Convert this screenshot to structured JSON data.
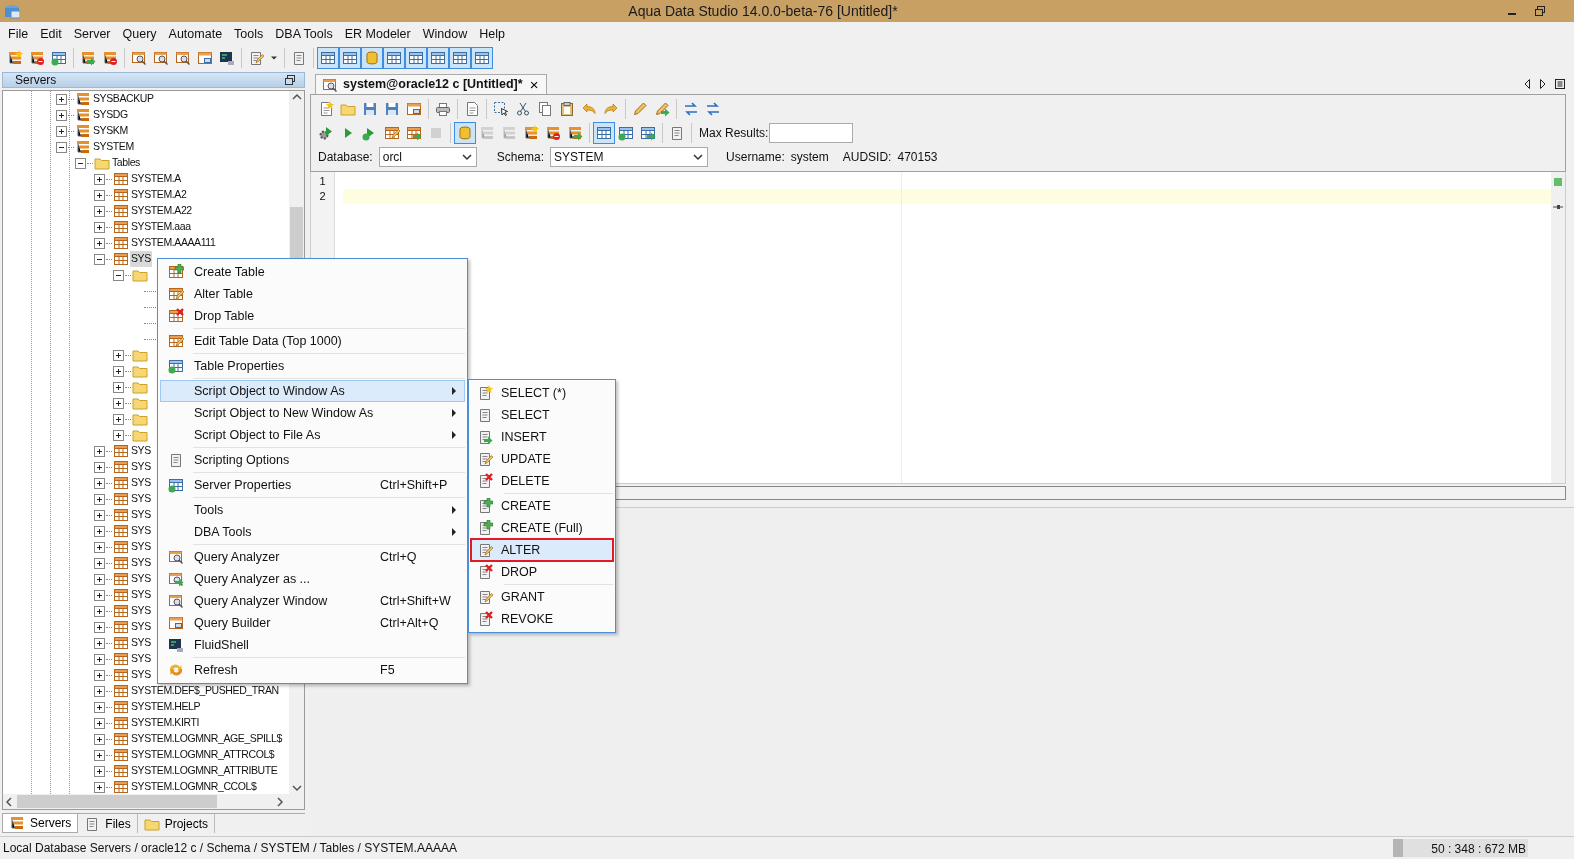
{
  "window": {
    "title": "Aqua Data Studio 14.0.0-beta-76 [Untitled]*"
  },
  "menu_bar": [
    "File",
    "Edit",
    "Server",
    "Query",
    "Automate",
    "Tools",
    "DBA Tools",
    "ER Modeler",
    "Window",
    "Help"
  ],
  "toolbar": [
    {
      "kind": "server-star",
      "pressed": false
    },
    {
      "kind": "server-ban",
      "pressed": false
    },
    {
      "kind": "grid-dot",
      "pressed": false
    },
    {
      "kind": "separator"
    },
    {
      "kind": "server-arrow",
      "pressed": false
    },
    {
      "kind": "server-ban",
      "pressed": false
    },
    {
      "kind": "separator"
    },
    {
      "kind": "magnifier",
      "pressed": false
    },
    {
      "kind": "magnifier",
      "pressed": false
    },
    {
      "kind": "magnifier",
      "pressed": false
    },
    {
      "kind": "window",
      "pressed": false
    },
    {
      "kind": "terminal",
      "pressed": false
    },
    {
      "kind": "separator"
    },
    {
      "kind": "scroll-pencil",
      "pressed": false
    },
    {
      "kind": "caret",
      "pressed": false
    },
    {
      "kind": "separator"
    },
    {
      "kind": "scroll",
      "pressed": false
    },
    {
      "kind": "separator"
    },
    {
      "kind": "grid",
      "pressed": true
    },
    {
      "kind": "grid",
      "pressed": true
    },
    {
      "kind": "cylinder",
      "pressed": true
    },
    {
      "kind": "grid",
      "pressed": true
    },
    {
      "kind": "grid",
      "pressed": true
    },
    {
      "kind": "grid",
      "pressed": true
    },
    {
      "kind": "grid",
      "pressed": true
    },
    {
      "kind": "grid",
      "pressed": true
    }
  ],
  "servers_panel": {
    "title": "Servers",
    "tree": [
      {
        "kind": "server",
        "label": "SYSBACKUP",
        "expanded": false,
        "selected": false
      },
      {
        "kind": "server",
        "label": "SYSDG",
        "expanded": false,
        "selected": false
      },
      {
        "kind": "server",
        "label": "SYSKM",
        "expanded": false,
        "selected": false
      },
      {
        "kind": "server",
        "label": "SYSTEM",
        "expanded": true,
        "selected": false,
        "children": [
          {
            "kind": "folder",
            "label": "Tables",
            "expanded": true,
            "selected": false,
            "children": [
              {
                "kind": "table",
                "label": "SYSTEM.A",
                "expanded": false,
                "selected": false
              },
              {
                "kind": "table",
                "label": "SYSTEM.A2",
                "expanded": false,
                "selected": false
              },
              {
                "kind": "table",
                "label": "SYSTEM.A22",
                "expanded": false,
                "selected": false
              },
              {
                "kind": "table",
                "label": "SYSTEM.aaa",
                "expanded": false,
                "selected": false
              },
              {
                "kind": "table",
                "label": "SYSTEM.AAAA111",
                "expanded": false,
                "selected": false
              },
              {
                "kind": "table",
                "label": "SYS",
                "expanded": true,
                "selected": true,
                "children": [
                  {
                    "kind": "folder",
                    "expanded": true,
                    "children": [
                      {
                        "kind": "covered"
                      },
                      {
                        "kind": "covered"
                      },
                      {
                        "kind": "covered"
                      },
                      {
                        "kind": "covered"
                      }
                    ]
                  },
                  {
                    "kind": "folder",
                    "expanded": false
                  },
                  {
                    "kind": "folder",
                    "expanded": false
                  },
                  {
                    "kind": "folder",
                    "expanded": false
                  },
                  {
                    "kind": "folder",
                    "expanded": false
                  },
                  {
                    "kind": "folder",
                    "expanded": false
                  },
                  {
                    "kind": "folder",
                    "expanded": false
                  }
                ]
              },
              {
                "kind": "table",
                "label": "SYS",
                "expanded": false,
                "selected": false
              },
              {
                "kind": "table",
                "label": "SYS",
                "expanded": false,
                "selected": false
              },
              {
                "kind": "table",
                "label": "SYS",
                "expanded": false,
                "selected": false
              },
              {
                "kind": "table",
                "label": "SYS",
                "expanded": false,
                "selected": false
              },
              {
                "kind": "table",
                "label": "SYS",
                "expanded": false,
                "selected": false
              },
              {
                "kind": "table",
                "label": "SYS",
                "expanded": false,
                "selected": false
              },
              {
                "kind": "table",
                "label": "SYS",
                "expanded": false,
                "selected": false
              },
              {
                "kind": "table",
                "label": "SYS",
                "expanded": false,
                "selected": false
              },
              {
                "kind": "table",
                "label": "SYS",
                "expanded": false,
                "selected": false
              },
              {
                "kind": "table",
                "label": "SYS",
                "expanded": false,
                "selected": false
              },
              {
                "kind": "table",
                "label": "SYS",
                "expanded": false,
                "selected": false
              },
              {
                "kind": "table",
                "label": "SYS",
                "expanded": false,
                "selected": false
              },
              {
                "kind": "table",
                "label": "SYS",
                "expanded": false,
                "selected": false
              },
              {
                "kind": "table",
                "label": "SYS",
                "expanded": false,
                "selected": false
              },
              {
                "kind": "table",
                "label": "SYS",
                "expanded": false,
                "selected": false
              },
              {
                "kind": "table",
                "label": "SYSTEM.DEF$_PUSHED_TRAN",
                "expanded": false,
                "selected": false
              },
              {
                "kind": "table",
                "label": "SYSTEM.HELP",
                "expanded": false,
                "selected": false
              },
              {
                "kind": "table",
                "label": "SYSTEM.KIRTI",
                "expanded": false,
                "selected": false
              },
              {
                "kind": "table",
                "label": "SYSTEM.LOGMNR_AGE_SPILL$",
                "expanded": false,
                "selected": false
              },
              {
                "kind": "table",
                "label": "SYSTEM.LOGMNR_ATTRCOL$",
                "expanded": false,
                "selected": false
              },
              {
                "kind": "table",
                "label": "SYSTEM.LOGMNR_ATTRIBUTE",
                "expanded": false,
                "selected": false
              },
              {
                "kind": "table",
                "label": "SYSTEM.LOGMNR_CCOL$",
                "expanded": false,
                "selected": false
              }
            ]
          }
        ]
      }
    ],
    "tabs": [
      {
        "kind": "server",
        "label": "Servers",
        "selected": true
      },
      {
        "kind": "scroll",
        "label": "Files",
        "selected": false
      },
      {
        "kind": "folder",
        "label": "Projects",
        "selected": false
      }
    ]
  },
  "editor": {
    "tab": {
      "label": "system@oracle12 c [Untitled]*",
      "close": "×"
    },
    "toolbar_rows": [
      [
        {
          "kind": "document-star"
        },
        {
          "kind": "folder"
        },
        {
          "kind": "floppy"
        },
        {
          "kind": "floppy"
        },
        {
          "kind": "window"
        },
        {
          "kind": "separator"
        },
        {
          "kind": "printer"
        },
        {
          "kind": "separator"
        },
        {
          "kind": "document"
        },
        {
          "kind": "separator"
        },
        {
          "kind": "selection"
        },
        {
          "kind": "scissors"
        },
        {
          "kind": "copy"
        },
        {
          "kind": "clipboard"
        },
        {
          "kind": "undo"
        },
        {
          "kind": "redo"
        },
        {
          "kind": "separator"
        },
        {
          "kind": "pencil"
        },
        {
          "kind": "pencil-arrow"
        },
        {
          "kind": "separator"
        },
        {
          "kind": "arrows"
        },
        {
          "kind": "arrows"
        }
      ],
      [
        {
          "kind": "gear",
          "pressed": false,
          "disabled": false
        },
        {
          "kind": "play",
          "pressed": false,
          "disabled": false
        },
        {
          "kind": "play-dot",
          "pressed": false,
          "disabled": false
        },
        {
          "kind": "table-pencil",
          "pressed": false,
          "disabled": false
        },
        {
          "kind": "table-arrow",
          "pressed": false,
          "disabled": false
        },
        {
          "kind": "stop",
          "pressed": false,
          "disabled": true
        },
        {
          "kind": "separator"
        },
        {
          "kind": "cylinder",
          "pressed": true,
          "disabled": false
        },
        {
          "kind": "server",
          "pressed": false,
          "disabled": true
        },
        {
          "kind": "server",
          "pressed": false,
          "disabled": true
        },
        {
          "kind": "server-star",
          "pressed": false,
          "disabled": false
        },
        {
          "kind": "server-ban",
          "pressed": false,
          "disabled": false
        },
        {
          "kind": "server-arrow",
          "pressed": false,
          "disabled": false
        },
        {
          "kind": "separator"
        },
        {
          "kind": "grid",
          "pressed": true,
          "disabled": false
        },
        {
          "kind": "grid-dot",
          "pressed": false,
          "disabled": false
        },
        {
          "kind": "grid-arrow",
          "pressed": false,
          "disabled": false
        },
        {
          "kind": "separator"
        },
        {
          "kind": "scroll",
          "pressed": false,
          "disabled": false
        },
        {
          "kind": "separator"
        }
      ]
    ],
    "max_results": {
      "label": "Max Results:"
    },
    "database": {
      "label": "Database:",
      "value": "orcl"
    },
    "schema": {
      "label": "Schema:",
      "value": "SYSTEM"
    },
    "username": {
      "label": "Username:",
      "value": "system"
    },
    "audsid": {
      "label": "AUDSID:",
      "value": "470153"
    },
    "lines": [
      {
        "number": "1",
        "current": false
      },
      {
        "number": "2",
        "current": true
      }
    ]
  },
  "context_menu": {
    "items": [
      {
        "kind": "table-plus",
        "label": "Create Table",
        "selected": false
      },
      {
        "kind": "table-pencil",
        "label": "Alter Table",
        "selected": false
      },
      {
        "kind": "table-x",
        "label": "Drop Table",
        "selected": false
      },
      {
        "kind": "separator"
      },
      {
        "kind": "table-pencil",
        "label": "Edit Table Data (Top 1000)",
        "selected": false
      },
      {
        "kind": "separator"
      },
      {
        "kind": "grid-dot",
        "label": "Table Properties",
        "selected": false
      },
      {
        "kind": "separator"
      },
      {
        "kind": "plain",
        "label": "Script Object to Window As",
        "submenu": true,
        "selected": true
      },
      {
        "kind": "plain",
        "label": "Script Object to New Window As",
        "submenu": true,
        "selected": false
      },
      {
        "kind": "plain",
        "label": "Script Object to File As",
        "submenu": true,
        "selected": false
      },
      {
        "kind": "separator"
      },
      {
        "kind": "scroll",
        "label": "Scripting Options",
        "selected": false
      },
      {
        "kind": "separator"
      },
      {
        "kind": "grid-dot",
        "label": "Server Properties",
        "shortcut": "Ctrl+Shift+P",
        "selected": false
      },
      {
        "kind": "separator"
      },
      {
        "kind": "plain",
        "label": "Tools",
        "submenu": true,
        "selected": false
      },
      {
        "kind": "plain",
        "label": "DBA Tools",
        "submenu": true,
        "selected": false
      },
      {
        "kind": "separator"
      },
      {
        "kind": "magnifier",
        "label": "Query Analyzer",
        "shortcut": "Ctrl+Q",
        "selected": false
      },
      {
        "kind": "magnifier-arrow",
        "label": "Query Analyzer as ...",
        "selected": false
      },
      {
        "kind": "magnifier",
        "label": "Query Analyzer Window",
        "shortcut": "Ctrl+Shift+W",
        "selected": false
      },
      {
        "kind": "window",
        "label": "Query Builder",
        "shortcut": "Ctrl+Alt+Q",
        "selected": false
      },
      {
        "kind": "terminal",
        "label": "FluidShell",
        "selected": false
      },
      {
        "kind": "separator"
      },
      {
        "kind": "refresh",
        "label": "Refresh",
        "shortcut": "F5",
        "selected": false
      }
    ]
  },
  "submenu": {
    "items": [
      {
        "kind": "scroll-star",
        "label": "SELECT (*)",
        "selected": false
      },
      {
        "kind": "scroll",
        "label": "SELECT",
        "selected": false
      },
      {
        "kind": "scroll-arrow",
        "label": "INSERT",
        "selected": false
      },
      {
        "kind": "scroll-pencil",
        "label": "UPDATE",
        "selected": false
      },
      {
        "kind": "scroll-x",
        "label": "DELETE",
        "selected": false
      },
      {
        "kind": "separator"
      },
      {
        "kind": "scroll-plus",
        "label": "CREATE",
        "selected": false
      },
      {
        "kind": "scroll-plus",
        "label": "CREATE (Full)",
        "selected": false
      },
      {
        "kind": "scroll-pencil",
        "label": "ALTER",
        "selected": true
      },
      {
        "kind": "scroll-x",
        "label": "DROP",
        "selected": false
      },
      {
        "kind": "separator"
      },
      {
        "kind": "scroll-pencil",
        "label": "GRANT",
        "selected": false
      },
      {
        "kind": "scroll-x",
        "label": "REVOKE",
        "selected": false
      }
    ]
  },
  "status_bar": {
    "path": "Local Database Servers / oracle12 c / Schema / SYSTEM / Tables / SYSTEM.AAAAA",
    "memory": {
      "reading": "50 : 348 : 672 MB",
      "level": 0.074
    }
  }
}
